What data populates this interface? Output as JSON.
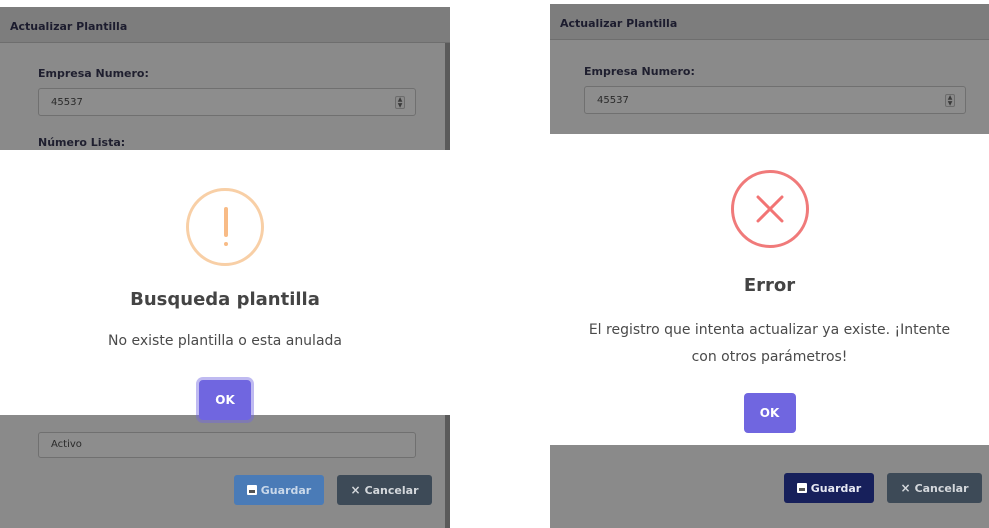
{
  "left": {
    "header": {
      "title": "Actualizar Plantilla"
    },
    "form": {
      "empresa_label": "Empresa Numero:",
      "empresa_value": "45537",
      "lista_label": "Número Lista:",
      "estado_value": "Activo"
    },
    "dialog": {
      "icon": "warning-icon",
      "title": "Busqueda plantilla",
      "message": "No existe plantilla o esta anulada",
      "ok_label": "OK"
    },
    "footer": {
      "save_label": "Guardar",
      "cancel_label": "Cancelar"
    }
  },
  "right": {
    "header": {
      "title": "Actualizar Plantilla"
    },
    "form": {
      "empresa_label": "Empresa Numero:",
      "empresa_value": "45537"
    },
    "dialog": {
      "icon": "error-icon",
      "title": "Error",
      "message_line1": "El registro que intenta actualizar ya existe. ¡Intente",
      "message_line2": "con otros parámetros!",
      "ok_label": "OK"
    },
    "footer": {
      "save_label": "Guardar",
      "cancel_label": "Cancelar"
    }
  },
  "colors": {
    "confirm": "#7066e0",
    "warning": "#f8bb86",
    "error": "#f27474",
    "save_left": "#4a7bb7",
    "save_right": "#17205b",
    "cancel": "#3d4a57"
  }
}
